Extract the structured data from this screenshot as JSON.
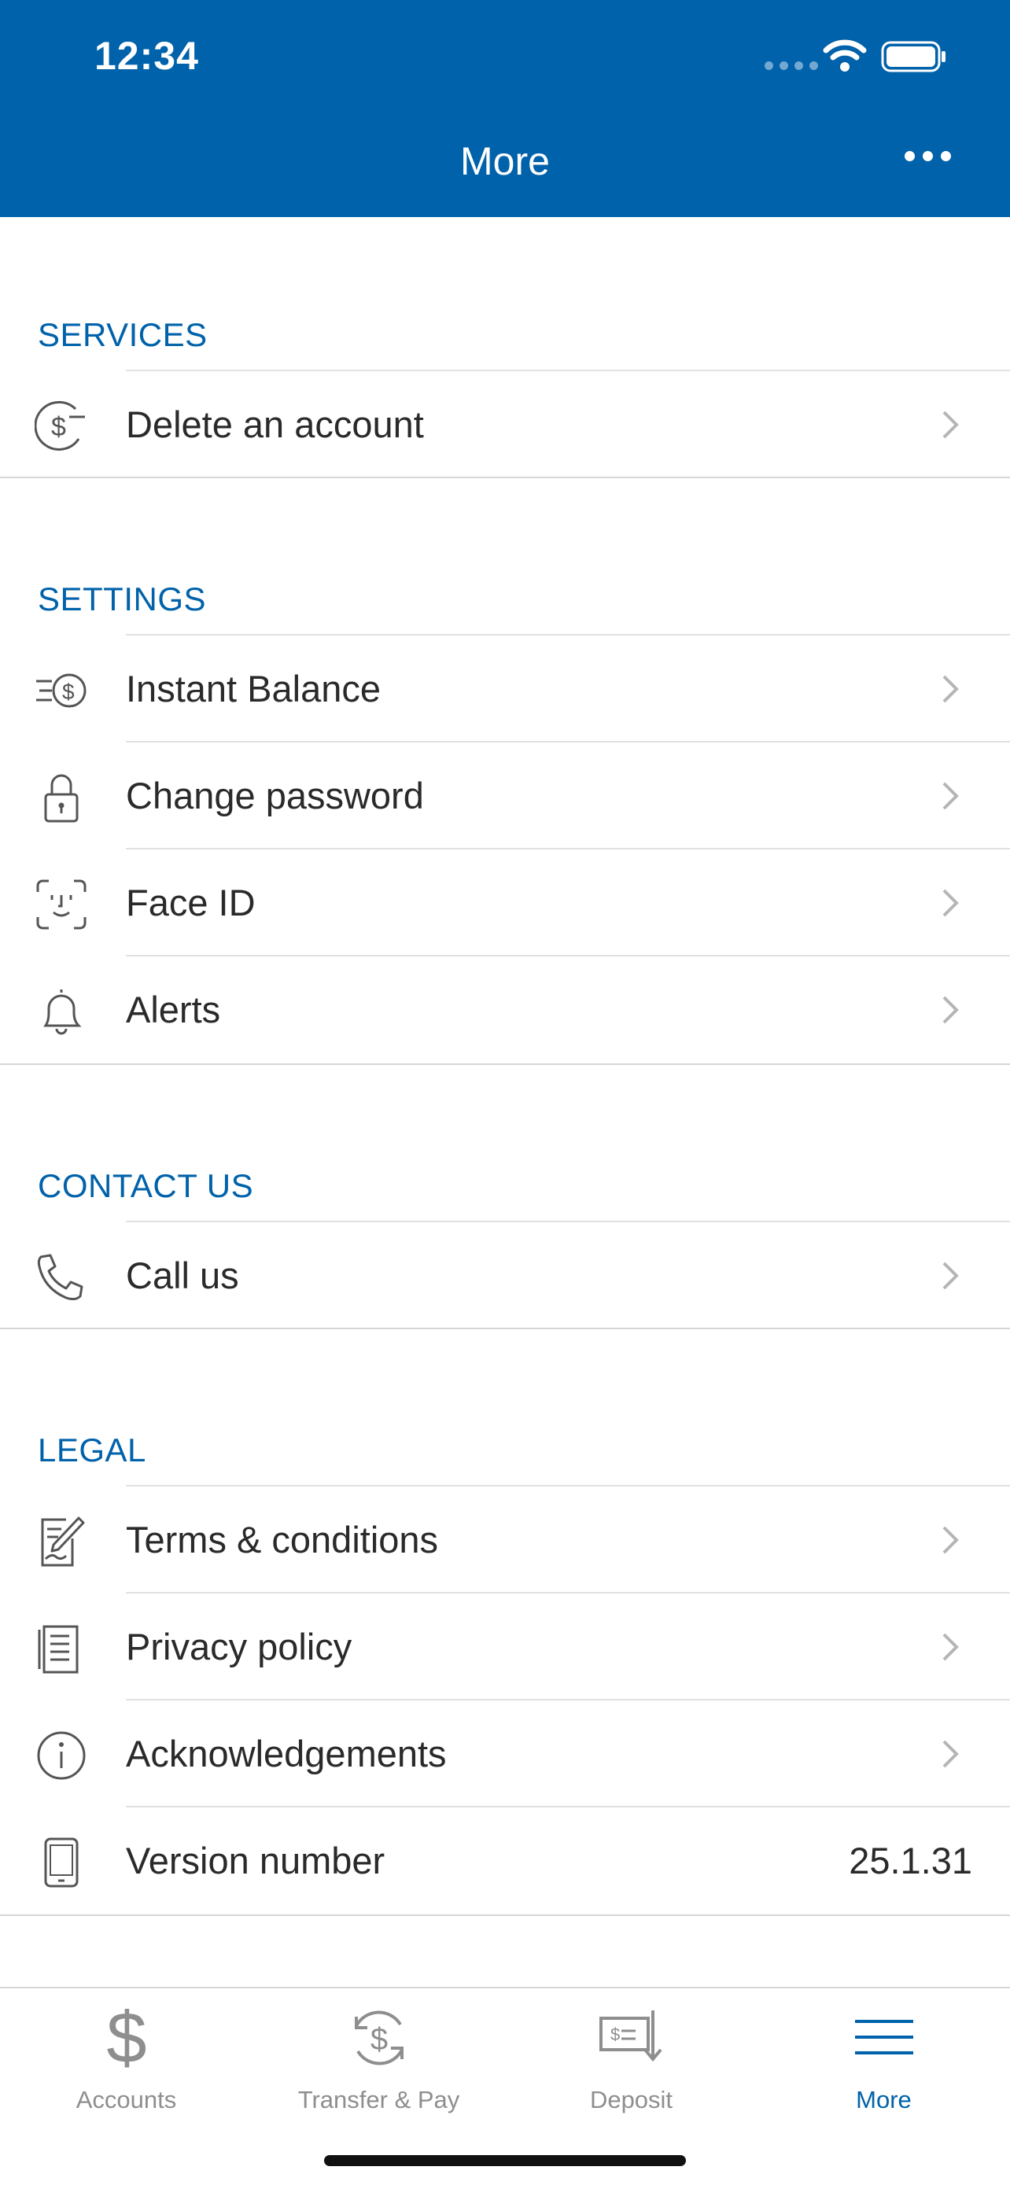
{
  "status_bar": {
    "time": "12:34"
  },
  "header": {
    "title": "More"
  },
  "sections": {
    "services": {
      "title": "SERVICES",
      "items": [
        {
          "label": "Delete an account",
          "icon": "dollar-circle-minus-icon"
        }
      ]
    },
    "settings": {
      "title": "SETTINGS",
      "items": [
        {
          "label": "Instant Balance",
          "icon": "fast-dollar-icon"
        },
        {
          "label": "Change password",
          "icon": "lock-icon"
        },
        {
          "label": "Face ID",
          "icon": "face-id-icon"
        },
        {
          "label": "Alerts",
          "icon": "bell-icon"
        }
      ]
    },
    "contact": {
      "title": "CONTACT US",
      "items": [
        {
          "label": "Call us",
          "icon": "phone-icon"
        }
      ]
    },
    "legal": {
      "title": "LEGAL",
      "items": [
        {
          "label": "Terms & conditions",
          "icon": "document-pencil-icon"
        },
        {
          "label": "Privacy policy",
          "icon": "document-icon"
        },
        {
          "label": "Acknowledgements",
          "icon": "info-icon"
        },
        {
          "label": "Version number",
          "icon": "phone-device-icon",
          "value": "25.1.31"
        }
      ]
    }
  },
  "tabbar": {
    "tabs": [
      {
        "label": "Accounts",
        "icon": "dollar-icon",
        "active": false
      },
      {
        "label": "Transfer & Pay",
        "icon": "transfer-icon",
        "active": false
      },
      {
        "label": "Deposit",
        "icon": "check-deposit-icon",
        "active": false
      },
      {
        "label": "More",
        "icon": "menu-icon",
        "active": true
      }
    ]
  },
  "colors": {
    "brand": "#0062AA",
    "inactive": "#8E8E8E",
    "divider": "#D6D6D6"
  }
}
